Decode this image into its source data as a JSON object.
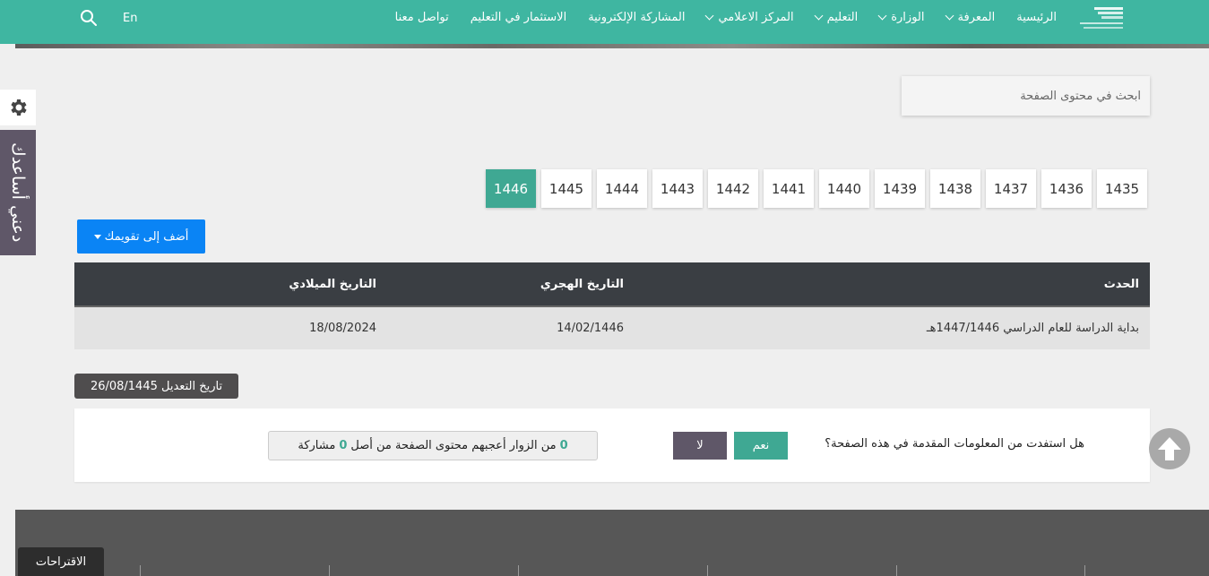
{
  "header": {
    "logo_icon": "ministry-logo-icon",
    "nav": [
      {
        "label": "الرئيسية",
        "dropdown": false
      },
      {
        "label": "المعرفة",
        "dropdown": true
      },
      {
        "label": "الوزارة",
        "dropdown": true
      },
      {
        "label": "التعليم",
        "dropdown": true
      },
      {
        "label": "المركز الاعلامي",
        "dropdown": true
      },
      {
        "label": "المشاركة الإلكترونية",
        "dropdown": false
      },
      {
        "label": "الاستثمار في التعليم",
        "dropdown": false
      },
      {
        "label": "تواصل معنا",
        "dropdown": false
      }
    ],
    "lang_label": "En",
    "search_icon": "search-icon"
  },
  "side": {
    "gear_icon": "gear-icon",
    "help_label": "دعني أساعدك"
  },
  "page_search": {
    "placeholder": "ابحث في محتوى الصفحة"
  },
  "years": [
    "1435",
    "1436",
    "1437",
    "1438",
    "1439",
    "1440",
    "1441",
    "1442",
    "1443",
    "1444",
    "1445",
    "1446"
  ],
  "active_year": "1446",
  "add_calendar": {
    "label": "أضف إلى تقويمك"
  },
  "table": {
    "headers": {
      "event": "الحدث",
      "hijri": "التاريخ الهجري",
      "gregorian": "التاريخ الميلادي"
    },
    "rows": [
      {
        "event": "بداية الدراسة للعام الدراسي 1447/1446هـ",
        "hijri": "14/02/1446",
        "gregorian": "18/08/2024"
      }
    ]
  },
  "modified": {
    "label": "تاريخ التعديل",
    "date": "26/08/1445"
  },
  "feedback": {
    "question": "هل استفدت من المعلومات المقدمة في هذه الصفحة؟",
    "yes_label": "نعم",
    "no_label": "لا",
    "liked_count": "0",
    "stats_middle": "من الزوار أعجبهم محتوى الصفحة من أصل",
    "total_count": "0",
    "stats_end": "مشاركة"
  },
  "suggestions_label": "الاقتراحات",
  "colors": {
    "brand": "#3fb6a1",
    "active": "#3fa893",
    "primary_button": "#0a84f5",
    "help_tab": "#5f5768"
  }
}
